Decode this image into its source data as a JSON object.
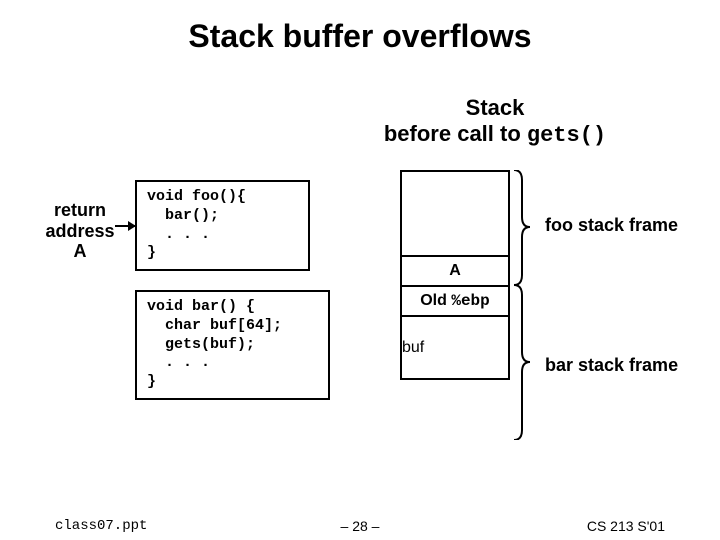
{
  "title": "Stack buffer overflows",
  "subtitle_line1": "Stack",
  "subtitle_line2_a": "before call to ",
  "subtitle_line2_b": "gets()",
  "return_label_l1": "return",
  "return_label_l2": "address",
  "return_label_l3": "A",
  "code1": "void foo(){\n  bar();\n  . . .\n}",
  "code2": "void bar() {\n  char buf[64];\n  gets(buf);\n  . . .\n}",
  "stack": {
    "a": "A",
    "old_ebp_a": "Old ",
    "old_ebp_b": "%ebp",
    "buf": "buf"
  },
  "frame1": "foo stack frame",
  "frame2": "bar stack frame",
  "footer": {
    "left": "class07.ppt",
    "center": "– 28 –",
    "right": "CS 213 S'01"
  }
}
